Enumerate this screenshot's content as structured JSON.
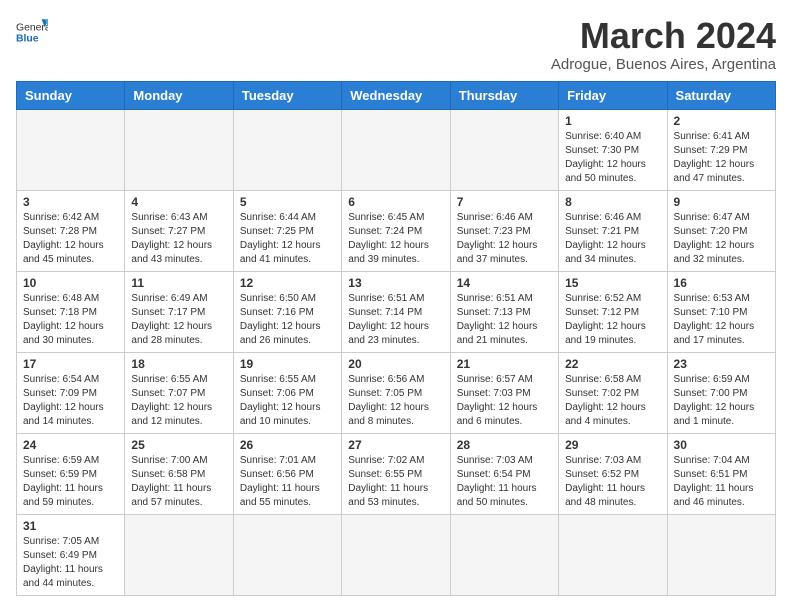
{
  "header": {
    "logo_general": "General",
    "logo_blue": "Blue",
    "title": "March 2024",
    "subtitle": "Adrogue, Buenos Aires, Argentina"
  },
  "weekdays": [
    "Sunday",
    "Monday",
    "Tuesday",
    "Wednesday",
    "Thursday",
    "Friday",
    "Saturday"
  ],
  "weeks": [
    [
      {
        "day": "",
        "info": ""
      },
      {
        "day": "",
        "info": ""
      },
      {
        "day": "",
        "info": ""
      },
      {
        "day": "",
        "info": ""
      },
      {
        "day": "",
        "info": ""
      },
      {
        "day": "1",
        "info": "Sunrise: 6:40 AM\nSunset: 7:30 PM\nDaylight: 12 hours\nand 50 minutes."
      },
      {
        "day": "2",
        "info": "Sunrise: 6:41 AM\nSunset: 7:29 PM\nDaylight: 12 hours\nand 47 minutes."
      }
    ],
    [
      {
        "day": "3",
        "info": "Sunrise: 6:42 AM\nSunset: 7:28 PM\nDaylight: 12 hours\nand 45 minutes."
      },
      {
        "day": "4",
        "info": "Sunrise: 6:43 AM\nSunset: 7:27 PM\nDaylight: 12 hours\nand 43 minutes."
      },
      {
        "day": "5",
        "info": "Sunrise: 6:44 AM\nSunset: 7:25 PM\nDaylight: 12 hours\nand 41 minutes."
      },
      {
        "day": "6",
        "info": "Sunrise: 6:45 AM\nSunset: 7:24 PM\nDaylight: 12 hours\nand 39 minutes."
      },
      {
        "day": "7",
        "info": "Sunrise: 6:46 AM\nSunset: 7:23 PM\nDaylight: 12 hours\nand 37 minutes."
      },
      {
        "day": "8",
        "info": "Sunrise: 6:46 AM\nSunset: 7:21 PM\nDaylight: 12 hours\nand 34 minutes."
      },
      {
        "day": "9",
        "info": "Sunrise: 6:47 AM\nSunset: 7:20 PM\nDaylight: 12 hours\nand 32 minutes."
      }
    ],
    [
      {
        "day": "10",
        "info": "Sunrise: 6:48 AM\nSunset: 7:18 PM\nDaylight: 12 hours\nand 30 minutes."
      },
      {
        "day": "11",
        "info": "Sunrise: 6:49 AM\nSunset: 7:17 PM\nDaylight: 12 hours\nand 28 minutes."
      },
      {
        "day": "12",
        "info": "Sunrise: 6:50 AM\nSunset: 7:16 PM\nDaylight: 12 hours\nand 26 minutes."
      },
      {
        "day": "13",
        "info": "Sunrise: 6:51 AM\nSunset: 7:14 PM\nDaylight: 12 hours\nand 23 minutes."
      },
      {
        "day": "14",
        "info": "Sunrise: 6:51 AM\nSunset: 7:13 PM\nDaylight: 12 hours\nand 21 minutes."
      },
      {
        "day": "15",
        "info": "Sunrise: 6:52 AM\nSunset: 7:12 PM\nDaylight: 12 hours\nand 19 minutes."
      },
      {
        "day": "16",
        "info": "Sunrise: 6:53 AM\nSunset: 7:10 PM\nDaylight: 12 hours\nand 17 minutes."
      }
    ],
    [
      {
        "day": "17",
        "info": "Sunrise: 6:54 AM\nSunset: 7:09 PM\nDaylight: 12 hours\nand 14 minutes."
      },
      {
        "day": "18",
        "info": "Sunrise: 6:55 AM\nSunset: 7:07 PM\nDaylight: 12 hours\nand 12 minutes."
      },
      {
        "day": "19",
        "info": "Sunrise: 6:55 AM\nSunset: 7:06 PM\nDaylight: 12 hours\nand 10 minutes."
      },
      {
        "day": "20",
        "info": "Sunrise: 6:56 AM\nSunset: 7:05 PM\nDaylight: 12 hours\nand 8 minutes."
      },
      {
        "day": "21",
        "info": "Sunrise: 6:57 AM\nSunset: 7:03 PM\nDaylight: 12 hours\nand 6 minutes."
      },
      {
        "day": "22",
        "info": "Sunrise: 6:58 AM\nSunset: 7:02 PM\nDaylight: 12 hours\nand 4 minutes."
      },
      {
        "day": "23",
        "info": "Sunrise: 6:59 AM\nSunset: 7:00 PM\nDaylight: 12 hours\nand 1 minute."
      }
    ],
    [
      {
        "day": "24",
        "info": "Sunrise: 6:59 AM\nSunset: 6:59 PM\nDaylight: 11 hours\nand 59 minutes."
      },
      {
        "day": "25",
        "info": "Sunrise: 7:00 AM\nSunset: 6:58 PM\nDaylight: 11 hours\nand 57 minutes."
      },
      {
        "day": "26",
        "info": "Sunrise: 7:01 AM\nSunset: 6:56 PM\nDaylight: 11 hours\nand 55 minutes."
      },
      {
        "day": "27",
        "info": "Sunrise: 7:02 AM\nSunset: 6:55 PM\nDaylight: 11 hours\nand 53 minutes."
      },
      {
        "day": "28",
        "info": "Sunrise: 7:03 AM\nSunset: 6:54 PM\nDaylight: 11 hours\nand 50 minutes."
      },
      {
        "day": "29",
        "info": "Sunrise: 7:03 AM\nSunset: 6:52 PM\nDaylight: 11 hours\nand 48 minutes."
      },
      {
        "day": "30",
        "info": "Sunrise: 7:04 AM\nSunset: 6:51 PM\nDaylight: 11 hours\nand 46 minutes."
      }
    ],
    [
      {
        "day": "31",
        "info": "Sunrise: 7:05 AM\nSunset: 6:49 PM\nDaylight: 11 hours\nand 44 minutes."
      },
      {
        "day": "",
        "info": ""
      },
      {
        "day": "",
        "info": ""
      },
      {
        "day": "",
        "info": ""
      },
      {
        "day": "",
        "info": ""
      },
      {
        "day": "",
        "info": ""
      },
      {
        "day": "",
        "info": ""
      }
    ]
  ]
}
